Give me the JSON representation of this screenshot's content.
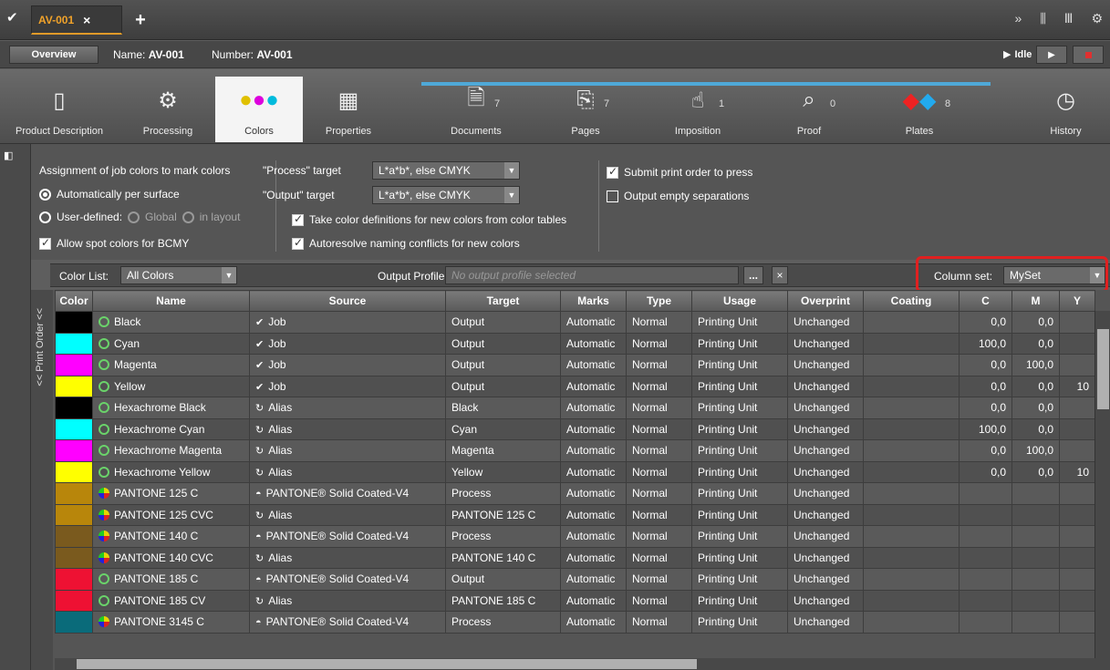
{
  "tabs": {
    "active": "AV-001",
    "close": "×",
    "add": "+"
  },
  "info": {
    "name_label": "Name:",
    "name_value": "AV-001",
    "number_label": "Number:",
    "number_value": "AV-001",
    "overview": "Overview",
    "status": "Idle"
  },
  "toolbar": {
    "product_description": "Product Description",
    "processing": "Processing",
    "colors": "Colors",
    "properties": "Properties",
    "documents": "Documents",
    "documents_count": "7",
    "pages": "Pages",
    "pages_count": "7",
    "imposition": "Imposition",
    "imposition_count": "1",
    "proof": "Proof",
    "proof_count": "0",
    "plates": "Plates",
    "plates_count": "8",
    "history": "History"
  },
  "settings": {
    "assignment_title": "Assignment of job colors to mark colors",
    "auto": "Automatically per surface",
    "user_defined": "User-defined:",
    "global": "Global",
    "in_layout": "in layout",
    "allow_spot": "Allow spot colors for BCMY",
    "process_target_label": "\"Process\" target",
    "process_target_value": "L*a*b*, else CMYK",
    "output_target_label": "\"Output\" target",
    "output_target_value": "L*a*b*, else CMYK",
    "take_color_defs": "Take color definitions for new colors from color tables",
    "autoresolve": "Autoresolve naming conflicts for new colors",
    "submit_print": "Submit print order to press",
    "output_empty": "Output empty separations"
  },
  "listbar": {
    "color_list_label": "Color List:",
    "color_list_value": "All Colors",
    "output_profile_label": "Output Profile:",
    "output_profile_placeholder": "No output profile selected",
    "browse": "...",
    "clear": "×",
    "column_set_label": "Column set:",
    "column_set_value": "MySet"
  },
  "print_order": "<< Print Order <<",
  "table": {
    "columns": [
      "Color",
      "Name",
      "Source",
      "Target",
      "Marks",
      "Type",
      "Usage",
      "Overprint",
      "Coating",
      "C",
      "M",
      "Y"
    ],
    "rows": [
      {
        "color": "#000000",
        "name": "Black",
        "dot": "green",
        "src_icon": "job",
        "source": "Job",
        "target": "Output",
        "marks": "Automatic",
        "type": "Normal",
        "usage": "Printing Unit",
        "overprint": "Unchanged",
        "c": "0,0",
        "m": "0,0",
        "y": ""
      },
      {
        "color": "#00ffff",
        "name": "Cyan",
        "dot": "green",
        "src_icon": "job",
        "source": "Job",
        "target": "Output",
        "marks": "Automatic",
        "type": "Normal",
        "usage": "Printing Unit",
        "overprint": "Unchanged",
        "c": "100,0",
        "m": "0,0",
        "y": ""
      },
      {
        "color": "#ff00ff",
        "name": "Magenta",
        "dot": "green",
        "src_icon": "job",
        "source": "Job",
        "target": "Output",
        "marks": "Automatic",
        "type": "Normal",
        "usage": "Printing Unit",
        "overprint": "Unchanged",
        "c": "0,0",
        "m": "100,0",
        "y": ""
      },
      {
        "color": "#ffff00",
        "name": "Yellow",
        "dot": "green",
        "src_icon": "job",
        "source": "Job",
        "target": "Output",
        "marks": "Automatic",
        "type": "Normal",
        "usage": "Printing Unit",
        "overprint": "Unchanged",
        "c": "0,0",
        "m": "0,0",
        "y": "10"
      },
      {
        "color": "#000000",
        "name": "Hexachrome Black",
        "dot": "green",
        "src_icon": "alias",
        "source": "Alias",
        "target": "Black",
        "marks": "Automatic",
        "type": "Normal",
        "usage": "Printing Unit",
        "overprint": "Unchanged",
        "c": "0,0",
        "m": "0,0",
        "y": ""
      },
      {
        "color": "#00ffff",
        "name": "Hexachrome Cyan",
        "dot": "green",
        "src_icon": "alias",
        "source": "Alias",
        "target": "Cyan",
        "marks": "Automatic",
        "type": "Normal",
        "usage": "Printing Unit",
        "overprint": "Unchanged",
        "c": "100,0",
        "m": "0,0",
        "y": ""
      },
      {
        "color": "#ff00ff",
        "name": "Hexachrome Magenta",
        "dot": "green",
        "src_icon": "alias",
        "source": "Alias",
        "target": "Magenta",
        "marks": "Automatic",
        "type": "Normal",
        "usage": "Printing Unit",
        "overprint": "Unchanged",
        "c": "0,0",
        "m": "100,0",
        "y": ""
      },
      {
        "color": "#ffff00",
        "name": "Hexachrome Yellow",
        "dot": "green",
        "src_icon": "alias",
        "source": "Alias",
        "target": "Yellow",
        "marks": "Automatic",
        "type": "Normal",
        "usage": "Printing Unit",
        "overprint": "Unchanged",
        "c": "0,0",
        "m": "0,0",
        "y": "10"
      },
      {
        "color": "#b8860b",
        "name": "PANTONE 125 C",
        "dot": "multi",
        "src_icon": "pantone",
        "source": "PANTONE® Solid Coated-V4",
        "target": "Process",
        "marks": "Automatic",
        "type": "Normal",
        "usage": "Printing Unit",
        "overprint": "Unchanged",
        "c": "",
        "m": "",
        "y": ""
      },
      {
        "color": "#b8860b",
        "name": "PANTONE 125 CVC",
        "dot": "multi",
        "src_icon": "alias",
        "source": "Alias",
        "target": "PANTONE 125 C",
        "marks": "Automatic",
        "type": "Normal",
        "usage": "Printing Unit",
        "overprint": "Unchanged",
        "c": "",
        "m": "",
        "y": ""
      },
      {
        "color": "#7a5a1e",
        "name": "PANTONE 140 C",
        "dot": "multi",
        "src_icon": "pantone",
        "source": "PANTONE® Solid Coated-V4",
        "target": "Process",
        "marks": "Automatic",
        "type": "Normal",
        "usage": "Printing Unit",
        "overprint": "Unchanged",
        "c": "",
        "m": "",
        "y": ""
      },
      {
        "color": "#7a5a1e",
        "name": "PANTONE 140 CVC",
        "dot": "multi",
        "src_icon": "alias",
        "source": "Alias",
        "target": "PANTONE 140 C",
        "marks": "Automatic",
        "type": "Normal",
        "usage": "Printing Unit",
        "overprint": "Unchanged",
        "c": "",
        "m": "",
        "y": ""
      },
      {
        "color": "#ee1133",
        "name": "PANTONE 185 C",
        "dot": "green",
        "src_icon": "pantone",
        "source": "PANTONE® Solid Coated-V4",
        "target": "Output",
        "marks": "Automatic",
        "type": "Normal",
        "usage": "Printing Unit",
        "overprint": "Unchanged",
        "c": "",
        "m": "",
        "y": ""
      },
      {
        "color": "#ee1133",
        "name": "PANTONE 185 CV",
        "dot": "green",
        "src_icon": "alias",
        "source": "Alias",
        "target": "PANTONE 185 C",
        "marks": "Automatic",
        "type": "Normal",
        "usage": "Printing Unit",
        "overprint": "Unchanged",
        "c": "",
        "m": "",
        "y": ""
      },
      {
        "color": "#0a6b7a",
        "name": "PANTONE 3145 C",
        "dot": "multi",
        "src_icon": "pantone",
        "source": "PANTONE® Solid Coated-V4",
        "target": "Process",
        "marks": "Automatic",
        "type": "Normal",
        "usage": "Printing Unit",
        "overprint": "Unchanged",
        "c": "",
        "m": "",
        "y": ""
      }
    ]
  }
}
